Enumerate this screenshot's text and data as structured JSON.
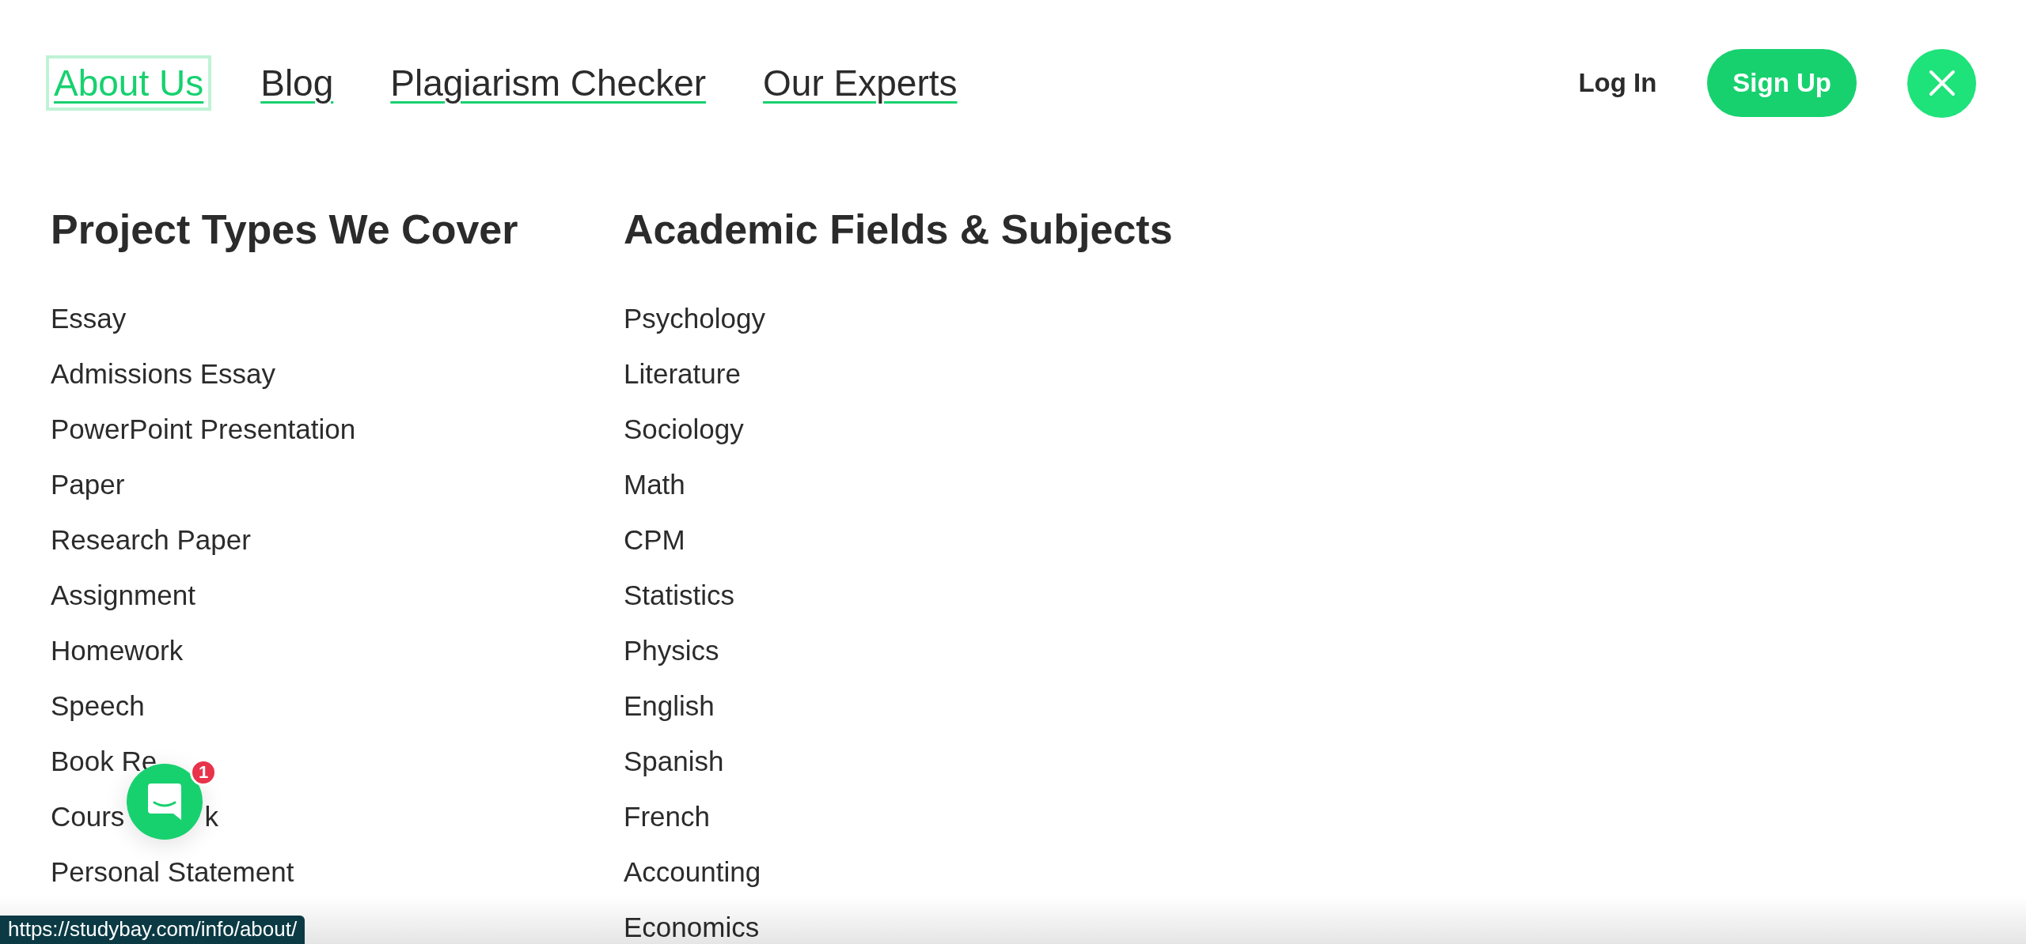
{
  "nav": {
    "links": [
      {
        "label": "About Us",
        "selected": true
      },
      {
        "label": "Blog",
        "selected": false
      },
      {
        "label": "Plagiarism Checker",
        "selected": false
      },
      {
        "label": "Our Experts",
        "selected": false
      }
    ],
    "login": "Log In",
    "signup": "Sign Up"
  },
  "menu": {
    "columns": [
      {
        "title": "Project Types We Cover",
        "items": [
          "Essay",
          "Admissions Essay",
          "PowerPoint Presentation",
          "Paper",
          "Research Paper",
          "Assignment",
          "Homework",
          "Speech",
          {
            "parts": [
              "Book Re"
            ]
          },
          {
            "parts": [
              "Cours",
              "k"
            ]
          },
          "Personal Statement"
        ]
      },
      {
        "title": "Academic Fields & Subjects",
        "items": [
          "Psychology",
          "Literature",
          "Sociology",
          "Math",
          "CPM",
          "Statistics",
          "Physics",
          "English",
          "Spanish",
          "French",
          "Accounting",
          "Economics"
        ]
      }
    ]
  },
  "chat": {
    "badge": "1"
  },
  "status_bar": "https://studybay.com/info/about/"
}
